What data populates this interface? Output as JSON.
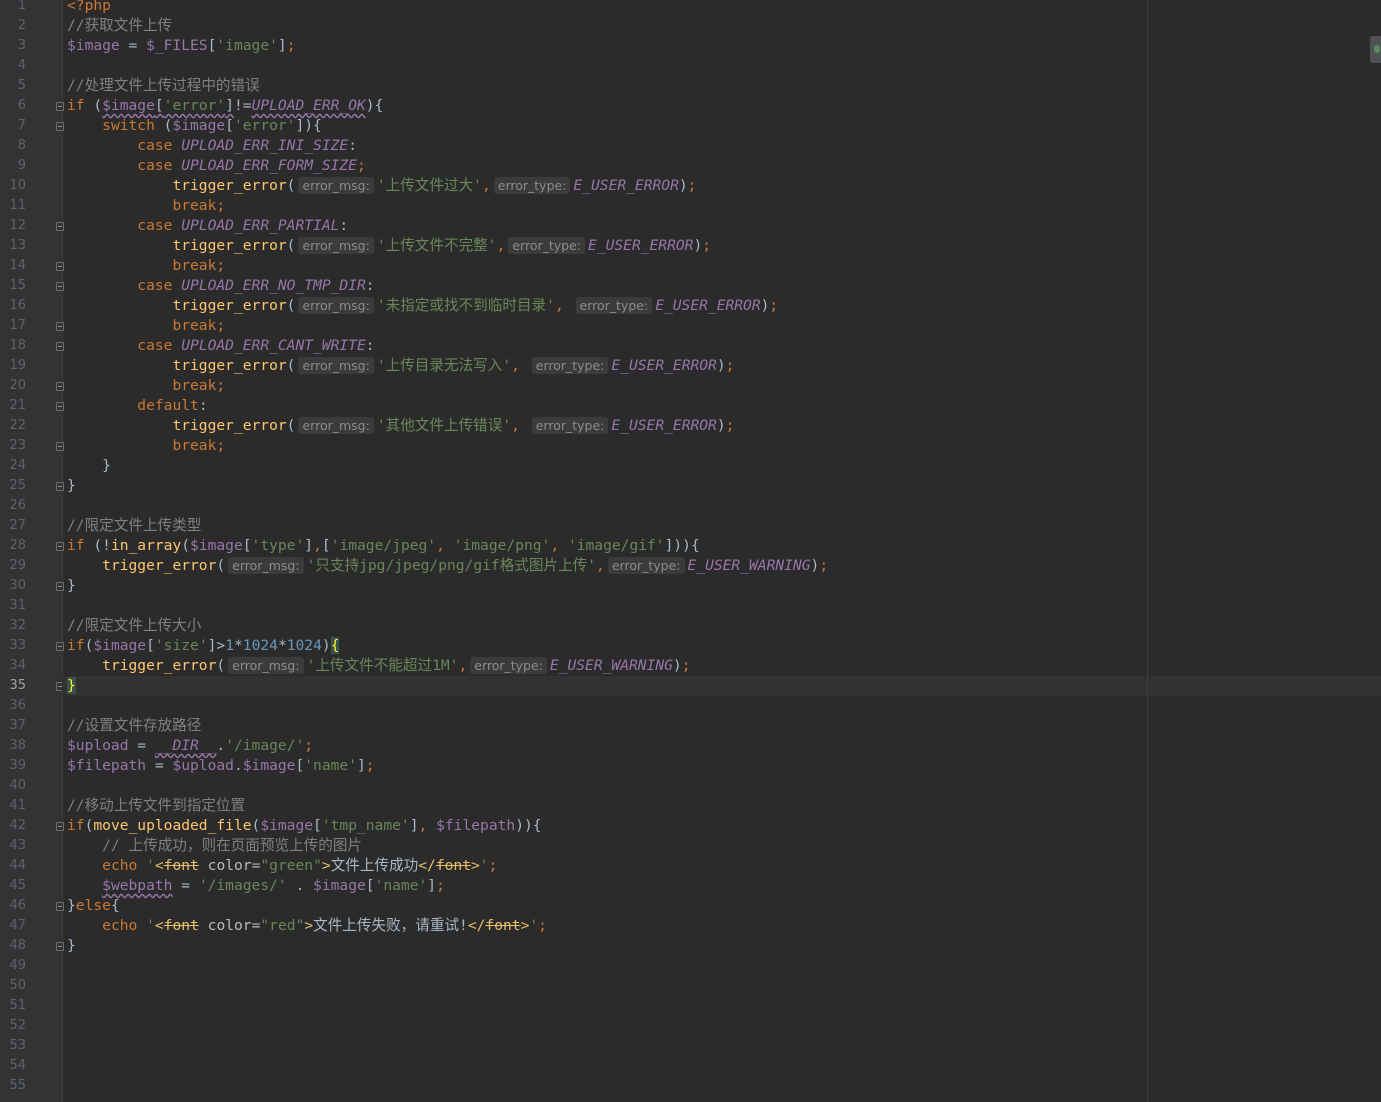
{
  "editor": {
    "active_line": 35,
    "line_numbers": [
      "1",
      "2",
      "3",
      "4",
      "5",
      "6",
      "7",
      "8",
      "9",
      "10",
      "11",
      "12",
      "13",
      "14",
      "15",
      "16",
      "17",
      "18",
      "19",
      "20",
      "21",
      "22",
      "23",
      "24",
      "25",
      "26",
      "27",
      "28",
      "29",
      "30",
      "31",
      "32",
      "33",
      "34",
      "35",
      "36",
      "37",
      "38",
      "39",
      "40",
      "41",
      "42",
      "43",
      "44",
      "45",
      "46",
      "47",
      "48",
      "49",
      "50",
      "51",
      "52",
      "53",
      "54",
      "55"
    ],
    "fold_lines": [
      6,
      7,
      12,
      14,
      15,
      17,
      18,
      20,
      21,
      23,
      25,
      28,
      30,
      33,
      35,
      42,
      46,
      48
    ],
    "colors": {
      "background": "#2b2b2b",
      "keyword": "#cc7832",
      "string": "#6a8759",
      "variable": "#9876aa",
      "function": "#ffc66d",
      "number": "#6897bb",
      "comment": "#808080"
    },
    "hints": {
      "msg": "error_msg:",
      "type": "error_type:"
    },
    "strings": {
      "php_open": "<?php",
      "c1": "//获取文件上传",
      "c2": "//处理文件上传过程中的错误",
      "s_ini": "'上传文件过大'",
      "s_partial": "'上传文件不完整'",
      "s_notmp": "'未指定或找不到临时目录'",
      "s_cantwrite": "'上传目录无法写入'",
      "s_other": "'其他文件上传错误'",
      "c3": "//限定文件上传类型",
      "s_types": "'只支持jpg/jpeg/png/gif格式图片上传'",
      "c4": "//限定文件上传大小",
      "s_size": "'上传文件不能超过1M'",
      "c5": "//设置文件存放路径",
      "c6": "//移动上传文件到指定位置",
      "c7": "// 上传成功，则在页面预览上传的图片",
      "s_success": "文件上传成功",
      "s_fail": "文件上传失败，请重试!"
    }
  }
}
